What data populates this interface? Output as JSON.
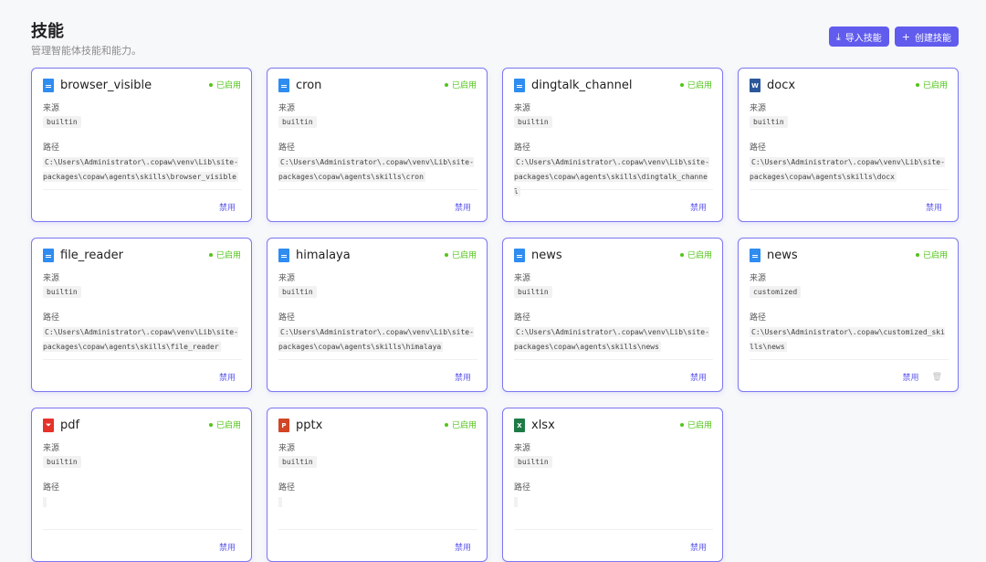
{
  "header": {
    "title": "技能",
    "subtitle": "管理智能体技能和能力。",
    "import_label": "导入技能",
    "create_label": "创建技能"
  },
  "labels": {
    "source": "来源",
    "path": "路径",
    "status": "已启用",
    "disable": "禁用"
  },
  "colors": {
    "accent": "#615ced",
    "enabled": "#52c41a",
    "card_border": "#7b77f0"
  },
  "skills": [
    {
      "name": "browser_visible",
      "icon": "doc-icon",
      "source": "builtin",
      "path": "C:\\Users\\Administrator\\.copaw\\venv\\Lib\\site-packages\\copaw\\agents\\skills\\browser_visible"
    },
    {
      "name": "cron",
      "icon": "doc-icon",
      "source": "builtin",
      "path": "C:\\Users\\Administrator\\.copaw\\venv\\Lib\\site-packages\\copaw\\agents\\skills\\cron"
    },
    {
      "name": "dingtalk_channel",
      "icon": "doc-icon",
      "source": "builtin",
      "path": "C:\\Users\\Administrator\\.copaw\\venv\\Lib\\site-packages\\copaw\\agents\\skills\\dingtalk_channel"
    },
    {
      "name": "docx",
      "icon": "word-icon",
      "source": "builtin",
      "path": "C:\\Users\\Administrator\\.copaw\\venv\\Lib\\site-packages\\copaw\\agents\\skills\\docx"
    },
    {
      "name": "file_reader",
      "icon": "doc-icon",
      "source": "builtin",
      "path": "C:\\Users\\Administrator\\.copaw\\venv\\Lib\\site-packages\\copaw\\agents\\skills\\file_reader"
    },
    {
      "name": "himalaya",
      "icon": "doc-icon",
      "source": "builtin",
      "path": "C:\\Users\\Administrator\\.copaw\\venv\\Lib\\site-packages\\copaw\\agents\\skills\\himalaya"
    },
    {
      "name": "news",
      "icon": "doc-icon",
      "source": "builtin",
      "path": "C:\\Users\\Administrator\\.copaw\\venv\\Lib\\site-packages\\copaw\\agents\\skills\\news"
    },
    {
      "name": "news",
      "icon": "doc-icon",
      "source": "customized",
      "path": "C:\\Users\\Administrator\\.copaw\\customized_skills\\news",
      "deletable": true
    },
    {
      "name": "pdf",
      "icon": "pdf-icon",
      "source": "builtin",
      "path": ""
    },
    {
      "name": "pptx",
      "icon": "ppt-icon",
      "source": "builtin",
      "path": ""
    },
    {
      "name": "xlsx",
      "icon": "excel-icon",
      "source": "builtin",
      "path": ""
    }
  ]
}
